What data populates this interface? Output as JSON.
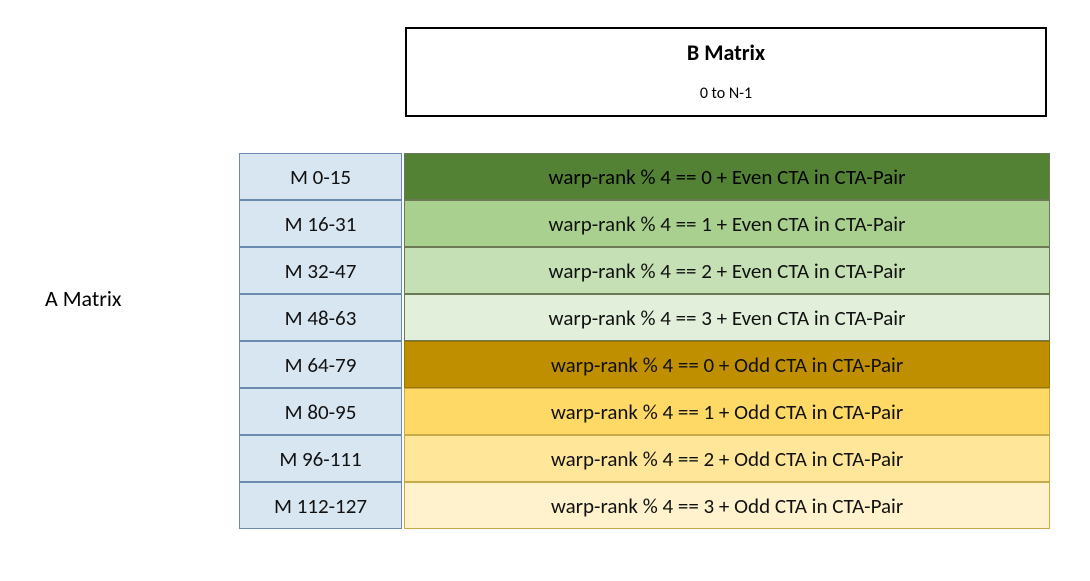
{
  "aMatrixLabel": "A Matrix",
  "bMatrix": {
    "title": "B Matrix",
    "range": "0 to N-1"
  },
  "rows": [
    {
      "m": "M 0-15",
      "desc": "warp-rank % 4 == 0  + Even CTA in CTA-Pair"
    },
    {
      "m": "M 16-31",
      "desc": "warp-rank % 4 == 1  + Even CTA in CTA-Pair"
    },
    {
      "m": "M 32-47",
      "desc": "warp-rank % 4 == 2  + Even CTA in CTA-Pair"
    },
    {
      "m": "M 48-63",
      "desc": "warp-rank % 4 == 3  + Even CTA in CTA-Pair"
    },
    {
      "m": "M 64-79",
      "desc": "warp-rank % 4 == 0  + Odd CTA in CTA-Pair"
    },
    {
      "m": "M 80-95",
      "desc": "warp-rank % 4 == 1  + Odd CTA in CTA-Pair"
    },
    {
      "m": "M 96-111",
      "desc": "warp-rank % 4 == 2  + Odd CTA in CTA-Pair"
    },
    {
      "m": "M 112-127",
      "desc": "warp-rank % 4 == 3  + Odd CTA in CTA-Pair"
    }
  ]
}
